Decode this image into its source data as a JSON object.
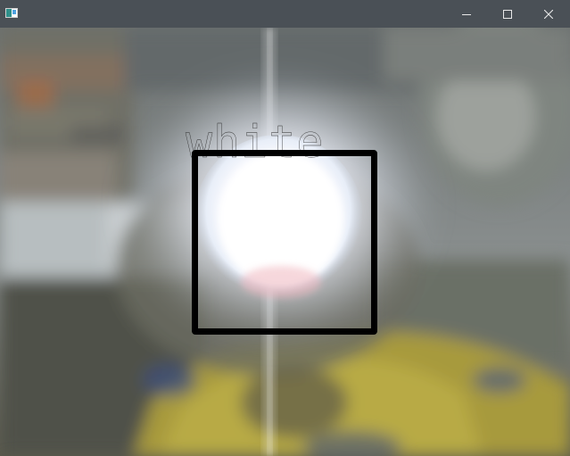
{
  "window": {
    "title": "",
    "buttons": {
      "minimize": "minimize-icon",
      "maximize": "maximize-icon",
      "close": "close-icon"
    },
    "titlebar_color": "#4a5056"
  },
  "camera": {
    "detected_color_label": "white",
    "box_color": "#000000"
  }
}
